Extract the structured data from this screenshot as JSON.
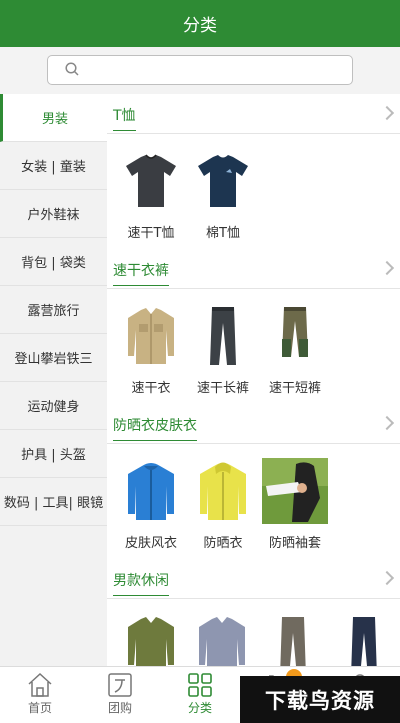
{
  "header": {
    "title": "分类"
  },
  "search": {
    "placeholder": "",
    "value": ""
  },
  "sidebar": {
    "items": [
      {
        "label": "男装",
        "active": true
      },
      {
        "label": "女装 | 童装"
      },
      {
        "label": "户外鞋袜"
      },
      {
        "label": "背包 | 袋类"
      },
      {
        "label": "露营旅行"
      },
      {
        "label": "登山攀岩铁三"
      },
      {
        "label": "运动健身"
      },
      {
        "label": "护具 | 头盔"
      },
      {
        "label": "数码 | 工具| 眼镜"
      }
    ]
  },
  "sections": [
    {
      "title": "T恤",
      "products": [
        {
          "label": "速干T恤",
          "icon": "tshirt-dark-icon"
        },
        {
          "label": "棉T恤",
          "icon": "tshirt-navy-icon"
        }
      ]
    },
    {
      "title": "速干衣裤",
      "products": [
        {
          "label": "速干衣",
          "icon": "khaki-shirt-icon"
        },
        {
          "label": "速干长裤",
          "icon": "long-pants-icon"
        },
        {
          "label": "速干短裤",
          "icon": "shorts-icon"
        }
      ]
    },
    {
      "title": "防晒衣皮肤衣",
      "products": [
        {
          "label": "皮肤风衣",
          "icon": "blue-jacket-icon"
        },
        {
          "label": "防晒衣",
          "icon": "yellow-jacket-icon"
        },
        {
          "label": "防晒袖套",
          "icon": "arm-sleeve-icon"
        }
      ]
    },
    {
      "title": "男款休闲",
      "products": [
        {
          "label": "",
          "icon": "olive-shirt-icon"
        },
        {
          "label": "",
          "icon": "grey-shirt-icon"
        },
        {
          "label": "",
          "icon": "grey-pants-icon"
        },
        {
          "label": "",
          "icon": "navy-pants-icon"
        }
      ]
    }
  ],
  "tabbar": {
    "items": [
      {
        "label": "首页",
        "icon": "home-icon"
      },
      {
        "label": "团购",
        "icon": "group-buy-icon"
      },
      {
        "label": "分类",
        "icon": "category-icon",
        "active": true
      },
      {
        "label": "",
        "icon": "cart-icon"
      },
      {
        "label": "",
        "icon": "user-icon"
      }
    ]
  },
  "watermark": {
    "text": "下载鸟资源"
  },
  "colors": {
    "brand": "#2e8b34",
    "sidebar_bg": "#f2f2f2",
    "badge": "#f29a1c"
  }
}
